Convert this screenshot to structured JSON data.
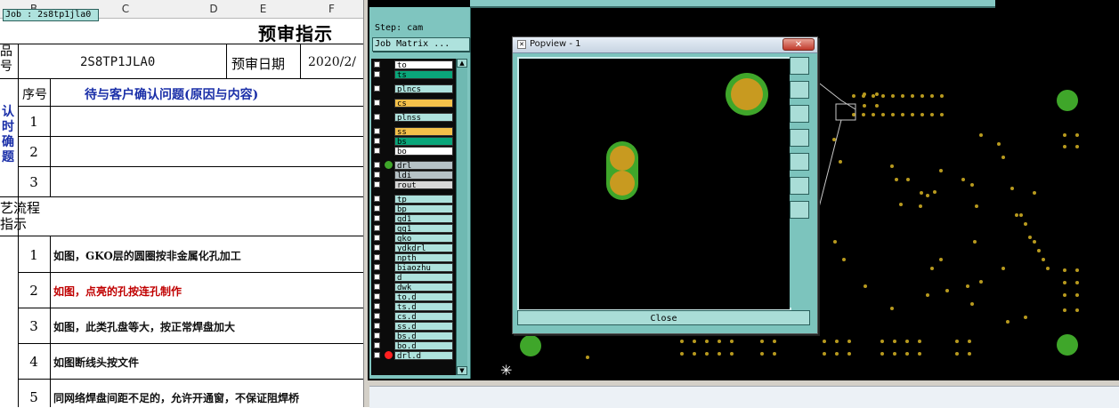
{
  "sheet": {
    "columns": [
      "B",
      "C",
      "D",
      "E",
      "F"
    ],
    "title": "预审指示",
    "product_label_partial": "品\n号",
    "part_number": "2S8TP1JLA0",
    "review_date_label": "预审日期",
    "review_date_partial": "2020/2/",
    "seq_label": "序号",
    "question_header": "待与客户确认问题(原因与内容)",
    "confirm_side_label": "认\n时\n确\n题",
    "confirm_rows": [
      "1",
      "2",
      "3"
    ],
    "process_label": "艺流程\n指示",
    "items": [
      {
        "num": "1",
        "text": "如图，GKO层的圆圈按非金属化孔加工",
        "color": "#111111"
      },
      {
        "num": "2",
        "text": "如图，点亮的孔按连孔制作",
        "color": "#c00000"
      },
      {
        "num": "3",
        "text": "如图，此类孔盘等大，按正常焊盘加大",
        "color": "#111111"
      },
      {
        "num": "4",
        "text": "如图断线头按文件",
        "color": "#111111"
      },
      {
        "num": "5",
        "text": "同网络焊盘间距不足的，允许开通窗，不保证阻焊桥",
        "color": "#111111"
      }
    ]
  },
  "cam": {
    "job_label": "Job : 2s8tp1jla0",
    "step_label": "Step: cam",
    "job_matrix_button": "Job Matrix ...",
    "layers": [
      {
        "name": "to",
        "color": "#ffffff",
        "dot": ""
      },
      {
        "name": "ts",
        "color": "#0aa67a",
        "dot": ""
      },
      {
        "name": "plncs",
        "color": "#aee2dd",
        "dot": ""
      },
      {
        "name": "cs",
        "color": "#f4c14a",
        "dot": ""
      },
      {
        "name": "plnss",
        "color": "#aee2dd",
        "dot": ""
      },
      {
        "name": "ss",
        "color": "#f4c14a",
        "dot": ""
      },
      {
        "name": "bs",
        "color": "#0aa67a",
        "dot": ""
      },
      {
        "name": "bo",
        "color": "#ffffff",
        "dot": ""
      },
      {
        "name": "drl",
        "color": "#b6c2c6",
        "dot": "#3fa62a"
      },
      {
        "name": "ldi",
        "color": "#b6c2c6",
        "dot": ""
      },
      {
        "name": "rout",
        "color": "#d8d8d8",
        "dot": ""
      },
      {
        "name": "tp",
        "color": "#aee2dd",
        "dot": ""
      },
      {
        "name": "bp",
        "color": "#aee2dd",
        "dot": ""
      },
      {
        "name": "gd1",
        "color": "#aee2dd",
        "dot": ""
      },
      {
        "name": "gg1",
        "color": "#aee2dd",
        "dot": ""
      },
      {
        "name": "gko",
        "color": "#aee2dd",
        "dot": ""
      },
      {
        "name": "ydkdrl",
        "color": "#aee2dd",
        "dot": ""
      },
      {
        "name": "npth",
        "color": "#aee2dd",
        "dot": ""
      },
      {
        "name": "biaozhu",
        "color": "#aee2dd",
        "dot": ""
      },
      {
        "name": "d",
        "color": "#aee2dd",
        "dot": ""
      },
      {
        "name": "dwk",
        "color": "#aee2dd",
        "dot": ""
      },
      {
        "name": "to.d",
        "color": "#aee2dd",
        "dot": ""
      },
      {
        "name": "ts.d",
        "color": "#aee2dd",
        "dot": ""
      },
      {
        "name": "cs.d",
        "color": "#aee2dd",
        "dot": ""
      },
      {
        "name": "ss.d",
        "color": "#aee2dd",
        "dot": ""
      },
      {
        "name": "bs.d",
        "color": "#aee2dd",
        "dot": ""
      },
      {
        "name": "bo.d",
        "color": "#aee2dd",
        "dot": ""
      },
      {
        "name": "drl.d",
        "color": "#aee2dd",
        "dot": "#ff2020"
      }
    ],
    "popview": {
      "title": "Popview - 1",
      "close_label": "Close",
      "tools": [
        "zoom-fit-icon",
        "zoom-in-icon",
        "zoom-out-icon",
        "pan-left-icon",
        "pan-right-icon",
        "zoom-area-icon",
        "refresh-icon"
      ]
    },
    "colors": {
      "pad_green": "#3fa62a",
      "pad_gold": "#c89a20",
      "panel_teal": "#7fc5bf"
    }
  }
}
